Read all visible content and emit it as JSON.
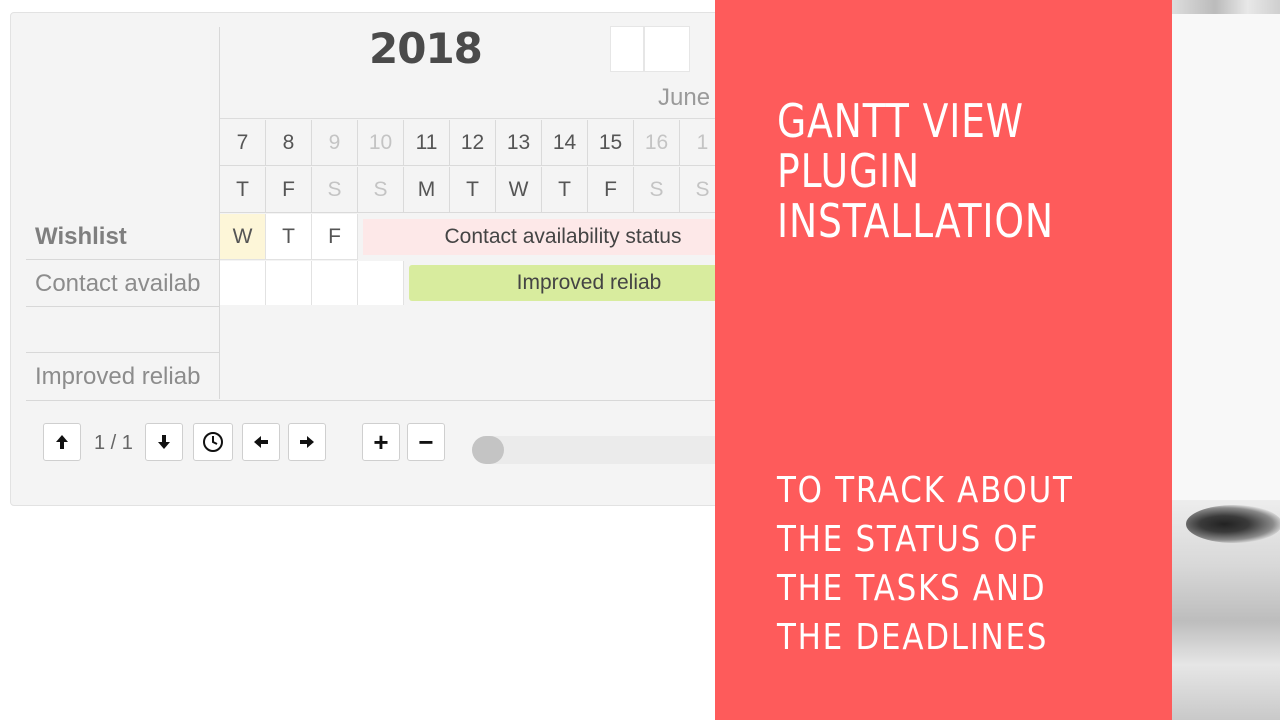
{
  "calendar": {
    "year": "2018",
    "month": "June",
    "days": [
      {
        "num": "7",
        "wd": "T",
        "weekend": false
      },
      {
        "num": "8",
        "wd": "F",
        "weekend": false
      },
      {
        "num": "9",
        "wd": "S",
        "weekend": true
      },
      {
        "num": "10",
        "wd": "S",
        "weekend": true
      },
      {
        "num": "11",
        "wd": "M",
        "weekend": false
      },
      {
        "num": "12",
        "wd": "T",
        "weekend": false
      },
      {
        "num": "13",
        "wd": "W",
        "weekend": false
      },
      {
        "num": "14",
        "wd": "T",
        "weekend": false
      },
      {
        "num": "15",
        "wd": "F",
        "weekend": false
      },
      {
        "num": "16",
        "wd": "S",
        "weekend": true
      },
      {
        "num": "1",
        "wd": "S",
        "weekend": true
      }
    ]
  },
  "rows": {
    "wishlist": "Wishlist",
    "wishlist_cells": [
      "W",
      "T",
      "F"
    ],
    "contact": "Contact availab",
    "improved": "Improved reliab"
  },
  "bars": {
    "contact": "Contact availability status",
    "improved": "Improved reliab"
  },
  "toolbar": {
    "up": "up-arrow",
    "pager": "1 / 1",
    "down": "down-arrow",
    "today": "clock",
    "prev": "left-arrow",
    "next": "right-arrow",
    "zoom_in": "+",
    "zoom_out": "−"
  },
  "overlay": {
    "headline": [
      "GANTT VIEW",
      "PLUGIN",
      "INSTALLATION"
    ],
    "sub": [
      "TO TRACK ABOUT",
      "THE STATUS OF",
      "THE TASKS AND",
      "THE DEADLINES"
    ],
    "panel_color": "#fe5b5b"
  }
}
